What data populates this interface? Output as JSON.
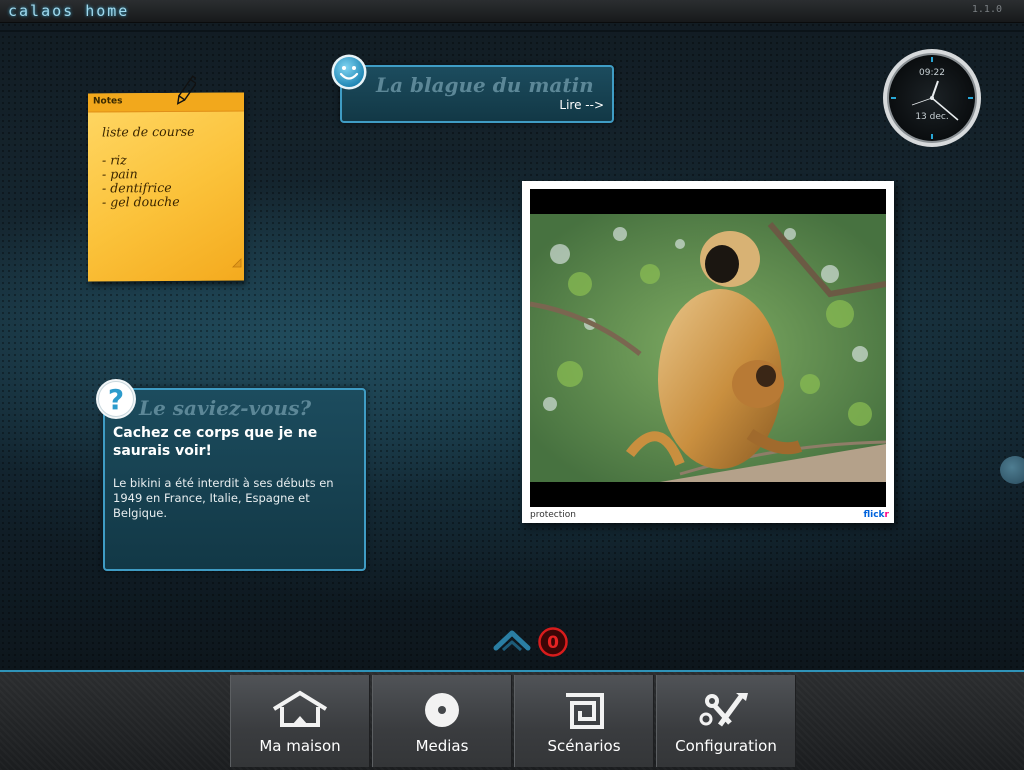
{
  "app": {
    "logo_text": "calaos home",
    "version": "1.1.0"
  },
  "notes_widget": {
    "title": "Notes",
    "lines": [
      "liste de course",
      "- riz",
      "- pain",
      "- dentifrice",
      "- gel douche"
    ]
  },
  "blague_widget": {
    "title": "La blague du matin",
    "read_label": "Lire -->"
  },
  "clock_widget": {
    "time": "09:22",
    "date": "13 dec."
  },
  "saviez_widget": {
    "title": "Le saviez-vous?",
    "headline": "Cachez ce corps que je ne saurais voir!",
    "body": "Le bikini a été interdit à ses débuts en 1949 en France, Italie, Espagne et Belgique."
  },
  "photo_widget": {
    "caption": "protection",
    "source_part1": "flick",
    "source_part2": "r"
  },
  "notification": {
    "count": "0"
  },
  "dock": {
    "items": [
      {
        "label": "Ma maison",
        "icon": "house-icon"
      },
      {
        "label": "Medias",
        "icon": "disc-icon"
      },
      {
        "label": "Scénarios",
        "icon": "spiral-icon"
      },
      {
        "label": "Configuration",
        "icon": "tools-icon"
      }
    ]
  },
  "colors": {
    "accent": "#3f9cc4",
    "note_yellow": "#fbc23a",
    "badge_red": "#d81c1c"
  }
}
